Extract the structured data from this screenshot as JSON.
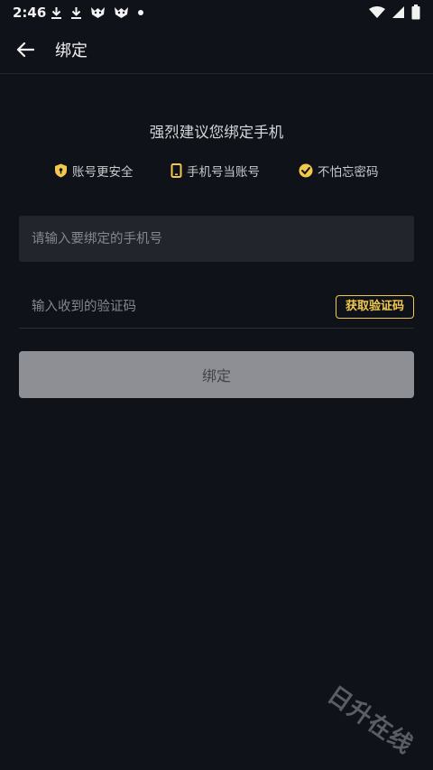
{
  "status_bar": {
    "time": "2:46",
    "left_icons": [
      "download-icon",
      "download-icon",
      "app-notification-icon",
      "app-notification-icon",
      "dot-icon"
    ],
    "right_icons": [
      "wifi-icon",
      "signal-icon",
      "battery-icon"
    ]
  },
  "appbar": {
    "back_icon": "arrow-left-icon",
    "title": "绑定"
  },
  "headline": "强烈建议您绑定手机",
  "features": [
    {
      "icon": "shield-icon",
      "label": "账号更安全"
    },
    {
      "icon": "phone-icon",
      "label": "手机号当账号"
    },
    {
      "icon": "check-badge-icon",
      "label": "不怕忘密码"
    }
  ],
  "form": {
    "phone_placeholder": "请输入要绑定的手机号",
    "code_placeholder": "输入收到的验证码",
    "get_code_label": "获取验证码",
    "submit_label": "绑定"
  },
  "watermark": "日升在线",
  "colors": {
    "background": "#101219",
    "accent": "#f2c94c",
    "input_bg": "#22252c",
    "button_disabled": "#8d8f94"
  }
}
